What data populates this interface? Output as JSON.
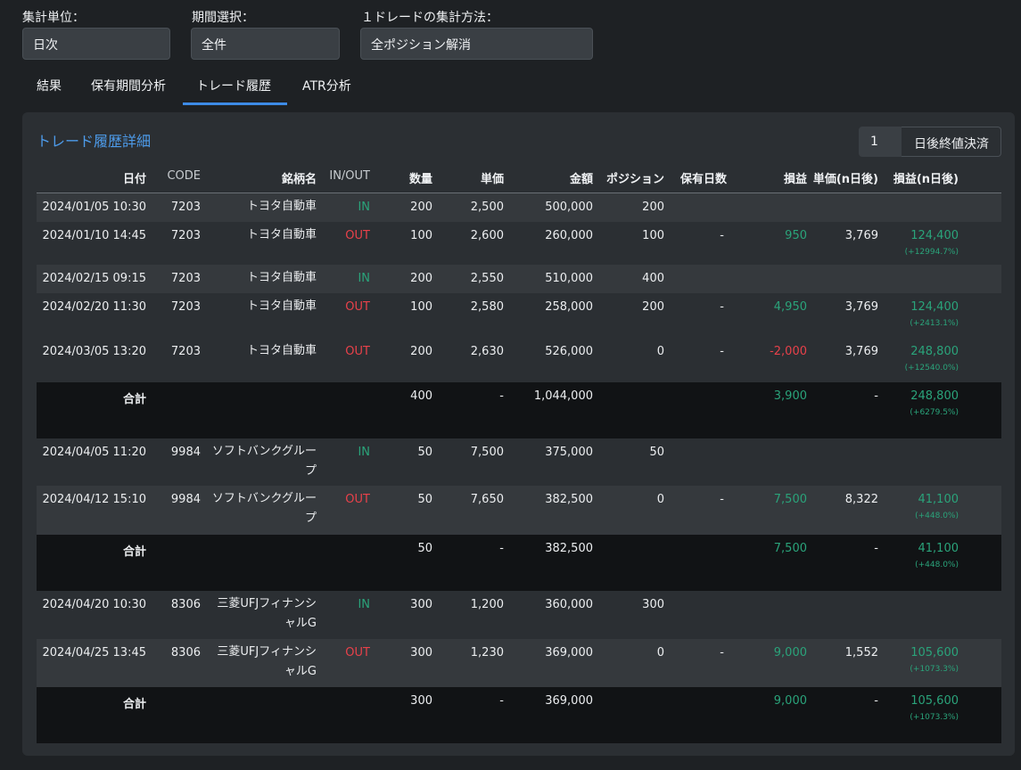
{
  "filters": {
    "unit": {
      "label": "集計単位：",
      "value": "日次"
    },
    "period": {
      "label": "期間選択：",
      "value": "全件"
    },
    "method": {
      "label": "１ドレードの集計方法：",
      "value": "全ポジション解消"
    }
  },
  "tabs": [
    "結果",
    "保有期間分析",
    "トレード履歴",
    "ATR分析"
  ],
  "active_tab": "トレード履歴",
  "panel": {
    "title": "トレード履歴詳細",
    "days_value": "1",
    "days_suffix": "日後終値決済"
  },
  "columns": {
    "date": "日付",
    "code": "CODE",
    "name": "銘柄名",
    "inout": "IN/OUT",
    "qty": "数量",
    "price": "単価",
    "amount": "金額",
    "position": "ポジション",
    "hold": "保有日数",
    "pnl": "損益",
    "price_n": "単価(n日後)",
    "pnl_n": "損益(n日後)"
  },
  "rows": [
    {
      "date": "2024/01/05 10:30",
      "code": "7203",
      "name": "トヨタ自動車",
      "inout": "IN",
      "qty": "200",
      "price": "2,500",
      "amount": "500,000",
      "position": "200",
      "hold": "",
      "pnl": "",
      "price_n": "",
      "pnl_n": "",
      "pct": ""
    },
    {
      "date": "2024/01/10 14:45",
      "code": "7203",
      "name": "トヨタ自動車",
      "inout": "OUT",
      "qty": "100",
      "price": "2,600",
      "amount": "260,000",
      "position": "100",
      "hold": "-",
      "pnl": "950",
      "price_n": "3,769",
      "pnl_n": "124,400",
      "pct": "(+12994.7%)"
    },
    {
      "date": "2024/02/15 09:15",
      "code": "7203",
      "name": "トヨタ自動車",
      "inout": "IN",
      "qty": "200",
      "price": "2,550",
      "amount": "510,000",
      "position": "400",
      "hold": "",
      "pnl": "",
      "price_n": "",
      "pnl_n": "",
      "pct": ""
    },
    {
      "date": "2024/02/20 11:30",
      "code": "7203",
      "name": "トヨタ自動車",
      "inout": "OUT",
      "qty": "100",
      "price": "2,580",
      "amount": "258,000",
      "position": "200",
      "hold": "-",
      "pnl": "4,950",
      "price_n": "3,769",
      "pnl_n": "124,400",
      "pct": "(+2413.1%)"
    },
    {
      "date": "2024/03/05 13:20",
      "code": "7203",
      "name": "トヨタ自動車",
      "inout": "OUT",
      "qty": "200",
      "price": "2,630",
      "amount": "526,000",
      "position": "0",
      "hold": "-",
      "pnl": "-2,000",
      "price_n": "3,769",
      "pnl_n": "248,800",
      "pct": "(+12540.0%)"
    },
    {
      "total": true,
      "date": "合計",
      "qty": "400",
      "price": "-",
      "amount": "1,044,000",
      "pnl": "3,900",
      "price_n": "-",
      "pnl_n": "248,800",
      "pct": "(+6279.5%)"
    },
    {
      "date": "2024/04/05 11:20",
      "code": "9984",
      "name1": "ソフトバンクグルー",
      "name2": "プ",
      "inout": "IN",
      "qty": "50",
      "price": "7,500",
      "amount": "375,000",
      "position": "50",
      "hold": "",
      "pnl": "",
      "price_n": "",
      "pnl_n": "",
      "pct": ""
    },
    {
      "date": "2024/04/12 15:10",
      "code": "9984",
      "name1": "ソフトバンクグルー",
      "name2": "プ",
      "inout": "OUT",
      "qty": "50",
      "price": "7,650",
      "amount": "382,500",
      "position": "0",
      "hold": "-",
      "pnl": "7,500",
      "price_n": "8,322",
      "pnl_n": "41,100",
      "pct": "(+448.0%)"
    },
    {
      "total": true,
      "date": "合計",
      "qty": "50",
      "price": "-",
      "amount": "382,500",
      "pnl": "7,500",
      "price_n": "-",
      "pnl_n": "41,100",
      "pct": "(+448.0%)"
    },
    {
      "date": "2024/04/20 10:30",
      "code": "8306",
      "name1": "三菱UFJフィナンシ",
      "name2": "ャルG",
      "inout": "IN",
      "qty": "300",
      "price": "1,200",
      "amount": "360,000",
      "position": "300",
      "hold": "",
      "pnl": "",
      "price_n": "",
      "pnl_n": "",
      "pct": ""
    },
    {
      "date": "2024/04/25 13:45",
      "code": "8306",
      "name1": "三菱UFJフィナンシ",
      "name2": "ャルG",
      "inout": "OUT",
      "qty": "300",
      "price": "1,230",
      "amount": "369,000",
      "position": "0",
      "hold": "-",
      "pnl": "9,000",
      "price_n": "1,552",
      "pnl_n": "105,600",
      "pct": "(+1073.3%)"
    },
    {
      "total": true,
      "date": "合計",
      "qty": "300",
      "price": "-",
      "amount": "369,000",
      "pnl": "9,000",
      "price_n": "-",
      "pnl_n": "105,600",
      "pct": "(+1073.3%)"
    }
  ]
}
